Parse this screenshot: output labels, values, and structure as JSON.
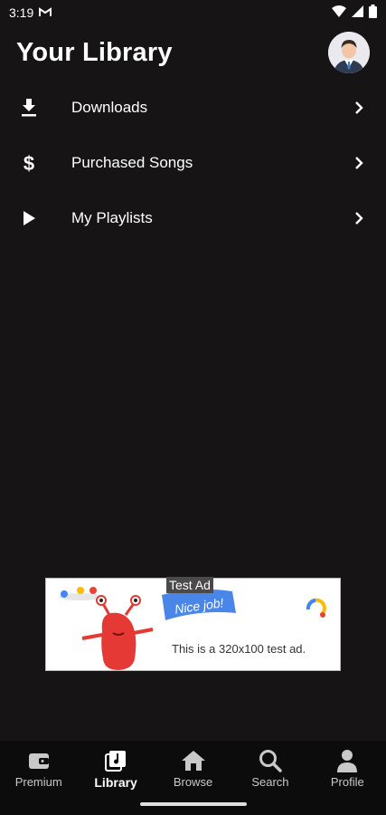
{
  "status_bar": {
    "time": "3:19"
  },
  "header": {
    "title": "Your Library"
  },
  "menu": {
    "items": [
      {
        "label": "Downloads",
        "icon": "download-icon"
      },
      {
        "label": "Purchased Songs",
        "icon": "dollar-icon"
      },
      {
        "label": "My Playlists",
        "icon": "play-icon"
      }
    ]
  },
  "ad": {
    "badge": "Test Ad",
    "banner_text": "Nice job!",
    "body_text": "This is a 320x100 test ad."
  },
  "bottom_nav": {
    "items": [
      {
        "label": "Premium",
        "icon": "wallet-icon",
        "active": false
      },
      {
        "label": "Library",
        "icon": "library-icon",
        "active": true
      },
      {
        "label": "Browse",
        "icon": "home-icon",
        "active": false
      },
      {
        "label": "Search",
        "icon": "search-icon",
        "active": false
      },
      {
        "label": "Profile",
        "icon": "person-icon",
        "active": false
      }
    ]
  },
  "colors": {
    "background": "#161414",
    "nav_background": "#0c0c0c",
    "text": "#ffffff"
  }
}
